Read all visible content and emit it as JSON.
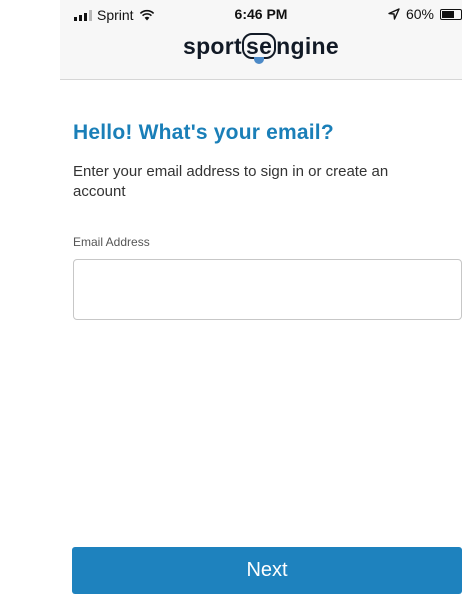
{
  "status_bar": {
    "carrier": "Sprint",
    "time": "6:46 PM",
    "battery_percent": "60%",
    "icons": [
      "signal-icon",
      "wifi-icon",
      "location-icon",
      "battery-icon"
    ]
  },
  "header": {
    "logo_text_before": "sport",
    "logo_text_seal": "se",
    "logo_text_after": "ngine"
  },
  "main": {
    "heading": "Hello! What's your email?",
    "subtext": "Enter your email address to sign in or create an account",
    "email_label": "Email Address",
    "email_value": "",
    "email_placeholder": ""
  },
  "footer": {
    "next_label": "Next"
  },
  "colors": {
    "accent": "#1a7fb8",
    "button": "#1e82be",
    "header_bg": "#f7f7f7"
  }
}
